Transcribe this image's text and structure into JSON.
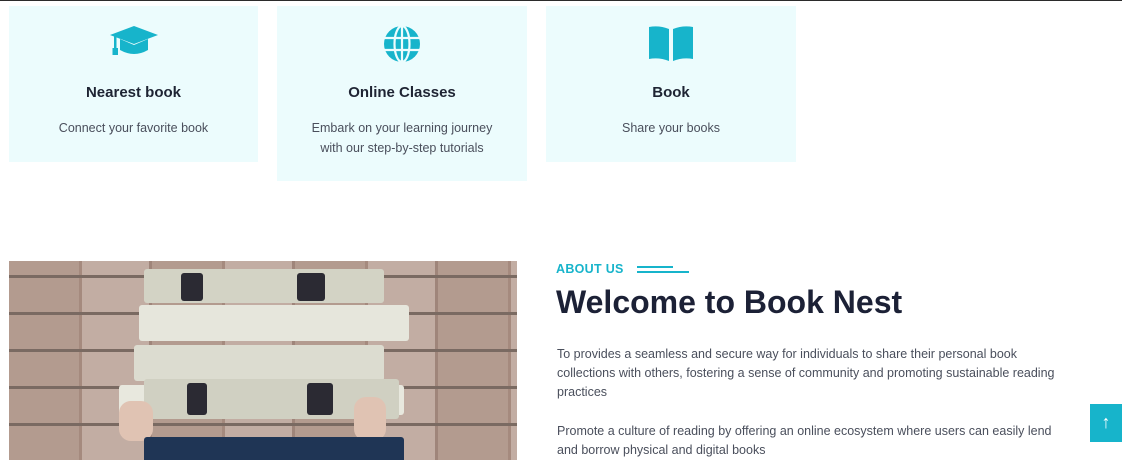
{
  "features": [
    {
      "icon": "graduation-cap-icon",
      "title": "Nearest book",
      "description": "Connect your favorite book"
    },
    {
      "icon": "globe-icon",
      "title": "Online Classes",
      "description": "Embark on your learning journey with our step-by-step tutorials"
    },
    {
      "icon": "open-book-icon",
      "title": "Book",
      "description": "Share your books"
    }
  ],
  "about": {
    "label": "ABOUT US",
    "headline": "Welcome to Book Nest",
    "paragraphs": [
      "To provides a seamless and secure way for individuals to share their personal book collections with others, fostering a sense of community and promoting sustainable reading practices",
      "Promote a culture of reading by offering an online ecosystem where users can easily lend and borrow physical and digital books"
    ]
  },
  "scroll_top": {
    "icon": "arrow-up-icon",
    "symbol": "↑"
  },
  "colors": {
    "accent": "#17b4cb",
    "card_bg": "#ecfcfd",
    "heading": "#1c2136"
  }
}
